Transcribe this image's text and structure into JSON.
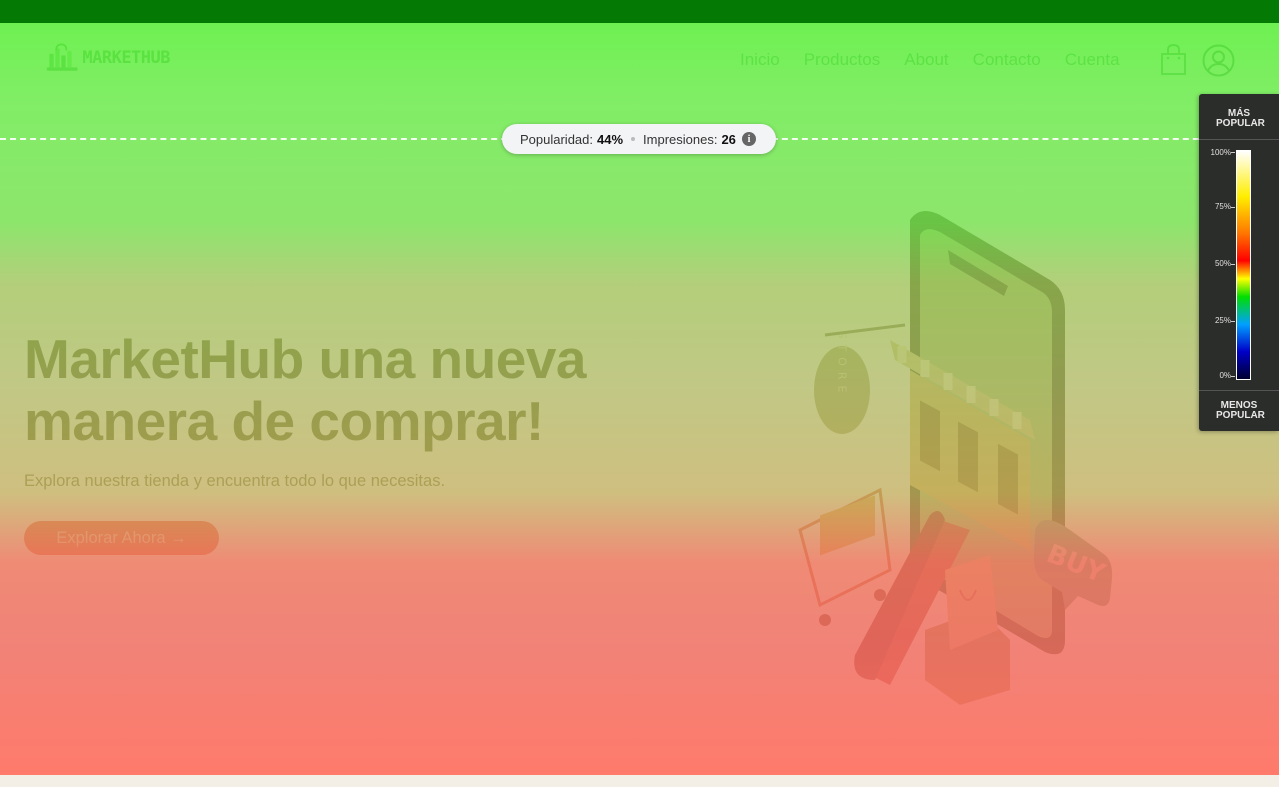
{
  "brand": {
    "name": "MARKETHUB"
  },
  "nav": {
    "items": [
      "Inicio",
      "Productos",
      "About",
      "Contacto",
      "Cuenta"
    ]
  },
  "stats": {
    "popularity_label": "Popularidad:",
    "popularity_value": "44%",
    "impressions_label": "Impresiones:",
    "impressions_value": "26"
  },
  "hero": {
    "title": "MarketHub una nueva manera de comprar!",
    "subtitle": "Explora nuestra tienda y encuentra todo lo que necesitas.",
    "cta_label": "Explorar Ahora →"
  },
  "legend": {
    "top_label": "MÁS POPULAR",
    "bottom_label": "MENOS POPULAR",
    "ticks": [
      "100%",
      "75%",
      "50%",
      "25%",
      "0%"
    ]
  },
  "illustration": {
    "store_sign": "STORE",
    "bubble_text": "BUY"
  },
  "colors": {
    "topbar": "#047a05",
    "brand": "#1d8f27",
    "cta": "#e24e2b",
    "legend_bg": "#2b2d2a"
  }
}
